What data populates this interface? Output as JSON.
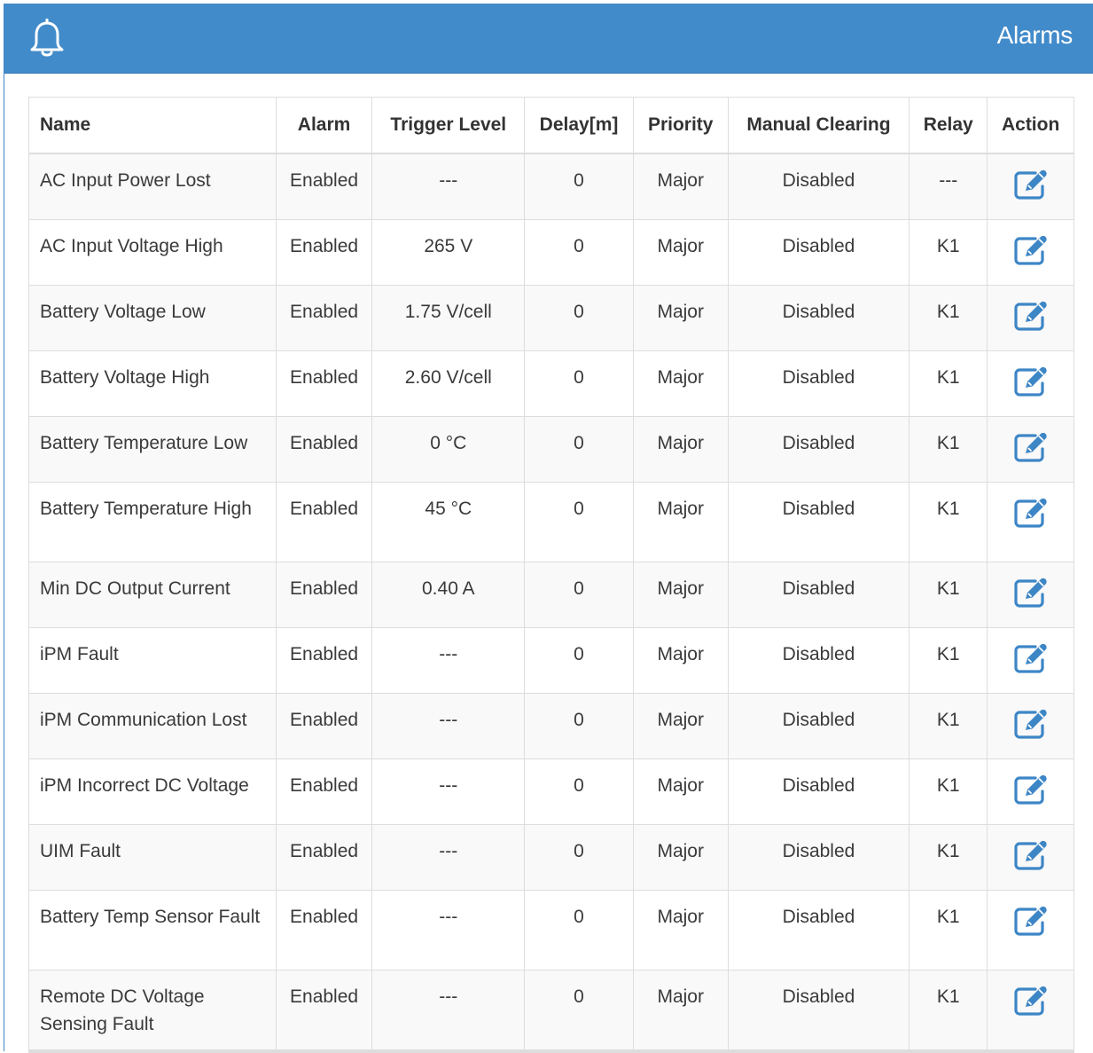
{
  "panel": {
    "title": "Alarms",
    "icon": "bell-icon",
    "accent_color": "#428bca"
  },
  "table": {
    "columns": [
      "Name",
      "Alarm",
      "Trigger Level",
      "Delay[m]",
      "Priority",
      "Manual Clearing",
      "Relay",
      "Action"
    ],
    "rows": [
      {
        "name": "AC Input Power Lost",
        "alarm": "Enabled",
        "trigger": "---",
        "delay": "0",
        "priority": "Major",
        "manual": "Disabled",
        "relay": "---",
        "action_icon": "edit-icon"
      },
      {
        "name": "AC Input Voltage High",
        "alarm": "Enabled",
        "trigger": "265 V",
        "delay": "0",
        "priority": "Major",
        "manual": "Disabled",
        "relay": "K1",
        "action_icon": "edit-icon"
      },
      {
        "name": "Battery Voltage Low",
        "alarm": "Enabled",
        "trigger": "1.75 V/cell",
        "delay": "0",
        "priority": "Major",
        "manual": "Disabled",
        "relay": "K1",
        "action_icon": "edit-icon"
      },
      {
        "name": "Battery Voltage High",
        "alarm": "Enabled",
        "trigger": "2.60 V/cell",
        "delay": "0",
        "priority": "Major",
        "manual": "Disabled",
        "relay": "K1",
        "action_icon": "edit-icon"
      },
      {
        "name": "Battery Temperature Low",
        "alarm": "Enabled",
        "trigger": "0 °C",
        "delay": "0",
        "priority": "Major",
        "manual": "Disabled",
        "relay": "K1",
        "action_icon": "edit-icon"
      },
      {
        "name": "Battery Temperature High",
        "alarm": "Enabled",
        "trigger": "45 °C",
        "delay": "0",
        "priority": "Major",
        "manual": "Disabled",
        "relay": "K1",
        "action_icon": "edit-icon"
      },
      {
        "name": "Min DC Output Current",
        "alarm": "Enabled",
        "trigger": "0.40 A",
        "delay": "0",
        "priority": "Major",
        "manual": "Disabled",
        "relay": "K1",
        "action_icon": "edit-icon"
      },
      {
        "name": "iPM Fault",
        "alarm": "Enabled",
        "trigger": "---",
        "delay": "0",
        "priority": "Major",
        "manual": "Disabled",
        "relay": "K1",
        "action_icon": "edit-icon"
      },
      {
        "name": "iPM Communication Lost",
        "alarm": "Enabled",
        "trigger": "---",
        "delay": "0",
        "priority": "Major",
        "manual": "Disabled",
        "relay": "K1",
        "action_icon": "edit-icon"
      },
      {
        "name": "iPM Incorrect DC Voltage",
        "alarm": "Enabled",
        "trigger": "---",
        "delay": "0",
        "priority": "Major",
        "manual": "Disabled",
        "relay": "K1",
        "action_icon": "edit-icon"
      },
      {
        "name": "UIM Fault",
        "alarm": "Enabled",
        "trigger": "---",
        "delay": "0",
        "priority": "Major",
        "manual": "Disabled",
        "relay": "K1",
        "action_icon": "edit-icon"
      },
      {
        "name": "Battery Temp Sensor Fault",
        "alarm": "Enabled",
        "trigger": "---",
        "delay": "0",
        "priority": "Major",
        "manual": "Disabled",
        "relay": "K1",
        "action_icon": "edit-icon"
      },
      {
        "name": "Remote DC Voltage Sensing Fault",
        "alarm": "Enabled",
        "trigger": "---",
        "delay": "0",
        "priority": "Major",
        "manual": "Disabled",
        "relay": "K1",
        "action_icon": "edit-icon"
      }
    ]
  }
}
